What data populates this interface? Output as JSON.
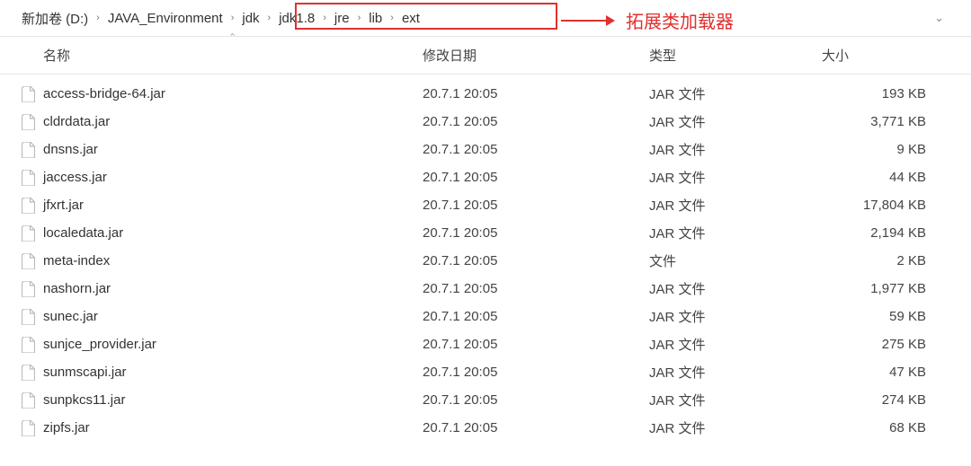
{
  "breadcrumb": {
    "items": [
      {
        "label": "新加卷 (D:)"
      },
      {
        "label": "JAVA_Environment"
      },
      {
        "label": "jdk"
      },
      {
        "label": "jdk1.8"
      },
      {
        "label": "jre"
      },
      {
        "label": "lib"
      },
      {
        "label": "ext"
      }
    ]
  },
  "annotation": {
    "text": "拓展类加载器"
  },
  "columns": {
    "name": "名称",
    "date": "修改日期",
    "type": "类型",
    "size": "大小"
  },
  "files": [
    {
      "name": "access-bridge-64.jar",
      "date": "20.7.1 20:05",
      "type": "JAR 文件",
      "size": "193 KB"
    },
    {
      "name": "cldrdata.jar",
      "date": "20.7.1 20:05",
      "type": "JAR 文件",
      "size": "3,771 KB"
    },
    {
      "name": "dnsns.jar",
      "date": "20.7.1 20:05",
      "type": "JAR 文件",
      "size": "9 KB"
    },
    {
      "name": "jaccess.jar",
      "date": "20.7.1 20:05",
      "type": "JAR 文件",
      "size": "44 KB"
    },
    {
      "name": "jfxrt.jar",
      "date": "20.7.1 20:05",
      "type": "JAR 文件",
      "size": "17,804 KB"
    },
    {
      "name": "localedata.jar",
      "date": "20.7.1 20:05",
      "type": "JAR 文件",
      "size": "2,194 KB"
    },
    {
      "name": "meta-index",
      "date": "20.7.1 20:05",
      "type": "文件",
      "size": "2 KB"
    },
    {
      "name": "nashorn.jar",
      "date": "20.7.1 20:05",
      "type": "JAR 文件",
      "size": "1,977 KB"
    },
    {
      "name": "sunec.jar",
      "date": "20.7.1 20:05",
      "type": "JAR 文件",
      "size": "59 KB"
    },
    {
      "name": "sunjce_provider.jar",
      "date": "20.7.1 20:05",
      "type": "JAR 文件",
      "size": "275 KB"
    },
    {
      "name": "sunmscapi.jar",
      "date": "20.7.1 20:05",
      "type": "JAR 文件",
      "size": "47 KB"
    },
    {
      "name": "sunpkcs11.jar",
      "date": "20.7.1 20:05",
      "type": "JAR 文件",
      "size": "274 KB"
    },
    {
      "name": "zipfs.jar",
      "date": "20.7.1 20:05",
      "type": "JAR 文件",
      "size": "68 KB"
    }
  ]
}
